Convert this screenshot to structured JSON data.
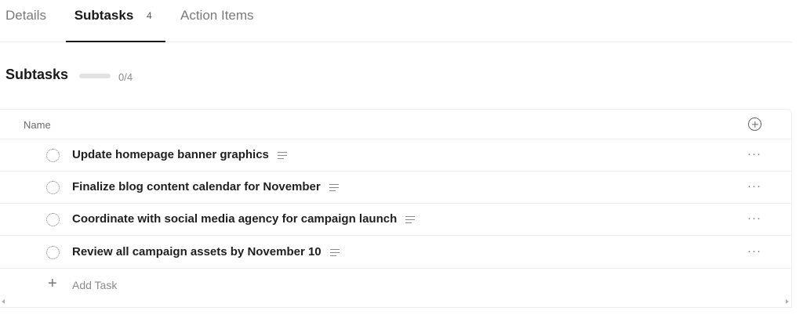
{
  "tabs": [
    {
      "label": "Details"
    },
    {
      "label": "Subtasks",
      "count": "4",
      "active": true
    },
    {
      "label": "Action Items"
    }
  ],
  "section": {
    "title": "Subtasks",
    "progress_text": "0/4",
    "progress_fraction": 0
  },
  "table": {
    "header_name": "Name",
    "rows": [
      {
        "title": "Update homepage banner graphics"
      },
      {
        "title": "Finalize blog content calendar for November"
      },
      {
        "title": "Coordinate with social media agency for campaign launch"
      },
      {
        "title": "Review all campaign assets by November 10"
      }
    ],
    "more_glyph": "···",
    "add_task_plus": "+",
    "add_task_label": "Add Task"
  },
  "icons": {
    "add_column": "plus-circle-icon",
    "task_status": "dotted-circle-icon",
    "description": "description-lines-icon",
    "row_menu": "ellipsis-icon"
  }
}
